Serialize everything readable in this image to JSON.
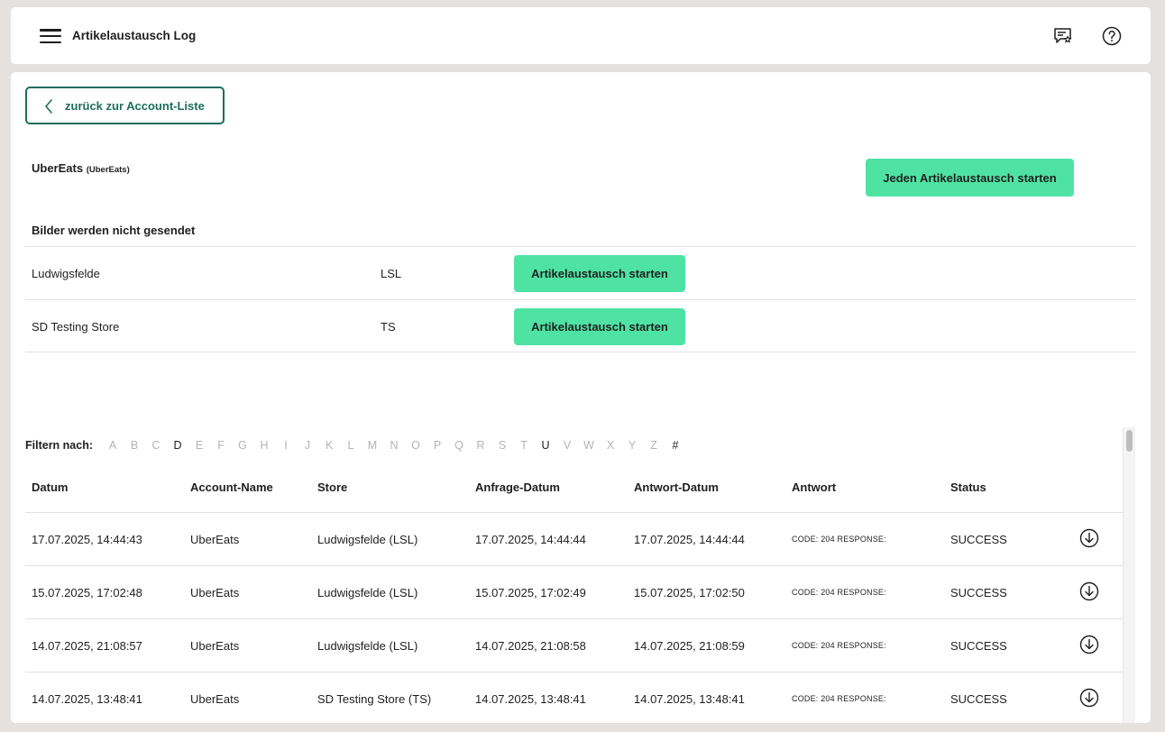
{
  "header": {
    "title": "Artikelaustausch Log",
    "icons": [
      "menu-icon",
      "feedback-icon",
      "help-icon"
    ]
  },
  "back_button": {
    "label": "zurück zur Account-Liste"
  },
  "account": {
    "name": "UberEats",
    "sub": "(UberEats)",
    "start_all_label": "Jeden Artikelaustausch starten",
    "images_note": "Bilder werden nicht gesendet"
  },
  "stores": [
    {
      "name": "Ludwigsfelde",
      "code": "LSL",
      "button": "Artikelaustausch starten"
    },
    {
      "name": "SD Testing Store",
      "code": "TS",
      "button": "Artikelaustausch starten"
    }
  ],
  "filter": {
    "label": "Filtern nach:",
    "letters": [
      "A",
      "B",
      "C",
      "D",
      "E",
      "F",
      "G",
      "H",
      "I",
      "J",
      "K",
      "L",
      "M",
      "N",
      "O",
      "P",
      "Q",
      "R",
      "S",
      "T",
      "U",
      "V",
      "W",
      "X",
      "Y",
      "Z",
      "#"
    ],
    "active": [
      "D",
      "U",
      "#"
    ]
  },
  "log": {
    "columns": [
      "Datum",
      "Account-Name",
      "Store",
      "Anfrage-Datum",
      "Antwort-Datum",
      "Antwort",
      "Status"
    ],
    "rows": [
      {
        "datum": "17.07.2025, 14:44:43",
        "account": "UberEats",
        "store": "Ludwigsfelde (LSL)",
        "anfrage": "17.07.2025, 14:44:44",
        "antwort_datum": "17.07.2025, 14:44:44",
        "antwort": "CODE: 204 RESPONSE:",
        "status": "SUCCESS"
      },
      {
        "datum": "15.07.2025, 17:02:48",
        "account": "UberEats",
        "store": "Ludwigsfelde (LSL)",
        "anfrage": "15.07.2025, 17:02:49",
        "antwort_datum": "15.07.2025, 17:02:50",
        "antwort": "CODE: 204 RESPONSE:",
        "status": "SUCCESS"
      },
      {
        "datum": "14.07.2025, 21:08:57",
        "account": "UberEats",
        "store": "Ludwigsfelde (LSL)",
        "anfrage": "14.07.2025, 21:08:58",
        "antwort_datum": "14.07.2025, 21:08:59",
        "antwort": "CODE: 204 RESPONSE:",
        "status": "SUCCESS"
      },
      {
        "datum": "14.07.2025, 13:48:41",
        "account": "UberEats",
        "store": "SD Testing Store (TS)",
        "anfrage": "14.07.2025, 13:48:41",
        "antwort_datum": "14.07.2025, 13:48:41",
        "antwort": "CODE: 204 RESPONSE:",
        "status": "SUCCESS"
      }
    ]
  },
  "colors": {
    "accent_green": "#4fe3a3",
    "dark_green": "#1b6e5a",
    "background": "#e4e1df"
  }
}
